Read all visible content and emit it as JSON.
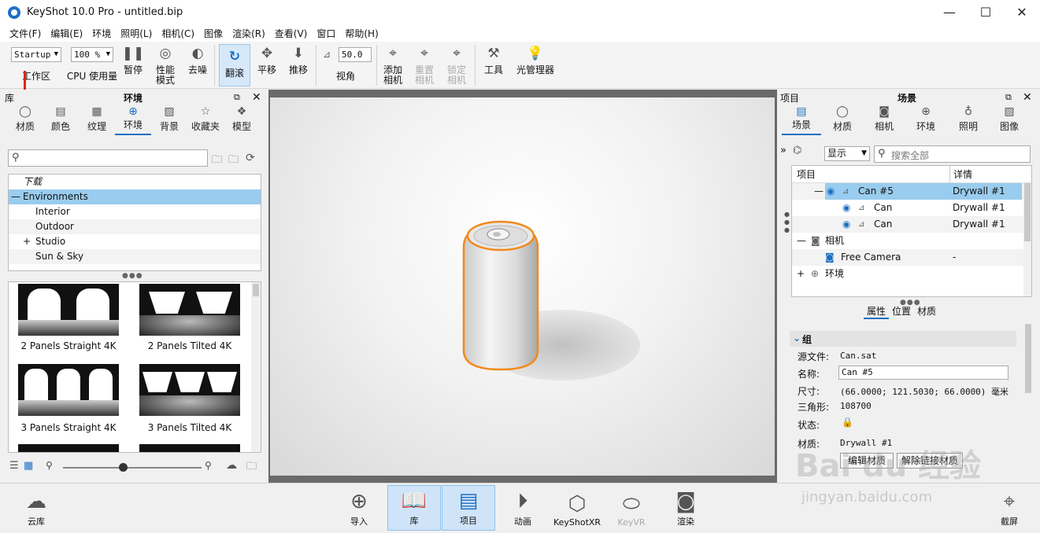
{
  "window": {
    "title": "KeyShot 10.0 Pro  - untitled.bip",
    "minimize": "—",
    "maximize": "☐",
    "close": "✕"
  },
  "menu": [
    "文件(F)",
    "编辑(E)",
    "环境",
    "照明(L)",
    "相机(C)",
    "图像",
    "渲染(R)",
    "查看(V)",
    "窗口",
    "帮助(H)"
  ],
  "toolbar": {
    "workspace_value": "Startup",
    "workspace_label": "工作区",
    "cpu_value": "100 %",
    "cpu_label": "CPU 使用量",
    "pause": "暂停",
    "perf_mode": "性能\n模式",
    "denoise": "去噪",
    "tumble": "翻滚",
    "pan": "平移",
    "dolly": "推移",
    "fov_value": "50.0",
    "fov_label": "视角",
    "add_camera": "添加\n相机",
    "reset_camera": "重置\n相机",
    "lock_camera": "锁定\n相机",
    "tools": "工具",
    "light_manager": "光管理器"
  },
  "library": {
    "header_left": "库",
    "header_title": "环境",
    "tabs": [
      "材质",
      "颜色",
      "纹理",
      "环境",
      "背景",
      "收藏夹",
      "模型"
    ],
    "active_tab": 3,
    "search_placeholder": "",
    "tree": [
      "下载",
      "Environments",
      "Interior",
      "Outdoor",
      "Studio",
      "Sun & Sky"
    ],
    "tree_expand": [
      "—",
      "+"
    ],
    "thumbnails": [
      "2 Panels Straight 4K",
      "2 Panels Tilted 4K",
      "3 Panels Straight 4K",
      "3 Panels Tilted 4K"
    ],
    "zoom_level": 0.43
  },
  "scene": {
    "header_left": "项目",
    "header_title": "场景",
    "tabs": [
      "场景",
      "材质",
      "相机",
      "环境",
      "照明",
      "图像"
    ],
    "active_tab": 0,
    "show_label": "显示",
    "search_placeholder": "搜索全部",
    "col_item": "项目",
    "col_detail": "详情",
    "rows": [
      {
        "name": "Can #5",
        "detail": "Drywall #1"
      },
      {
        "name": "Can",
        "detail": "Drywall #1"
      },
      {
        "name": "Can",
        "detail": "Drywall #1"
      },
      {
        "name": "相机",
        "detail": ""
      },
      {
        "name": "Free Camera",
        "detail": "-"
      },
      {
        "name": "环境",
        "detail": ""
      }
    ],
    "tree_expand": [
      "—",
      "—",
      "+"
    ],
    "sub_tabs": [
      "属性",
      "位置",
      "材质"
    ],
    "group_label": "组",
    "props": {
      "source_k": "源文件:",
      "source_v": "Can.sat",
      "name_k": "名称:",
      "name_v": "Can #5",
      "size_k": "尺寸:",
      "size_v": "(66.0000; 121.5030; 66.0000) 毫米",
      "tri_k": "三角形:",
      "tri_v": "108700",
      "state_k": "状态:",
      "mat_k": "材质:",
      "mat_v": "Drywall #1",
      "edit_mat": "编辑材质",
      "unlink_mat": "解除链接材质"
    }
  },
  "bottom": {
    "cloud": "云库",
    "import": "导入",
    "library": "库",
    "project": "项目",
    "animation": "动画",
    "keyshotxr": "KeyShotXR",
    "keyvr": "KeyVR",
    "render": "渲染",
    "screenshot": "截屏"
  },
  "watermark": {
    "line1": "Bai du 经验",
    "line2": "jingyan.baidu.com"
  },
  "colors": {
    "accent": "#1c6fc4",
    "selection": "#99ccee",
    "outline": "#f28a1c",
    "annotation": "#e3201b"
  }
}
